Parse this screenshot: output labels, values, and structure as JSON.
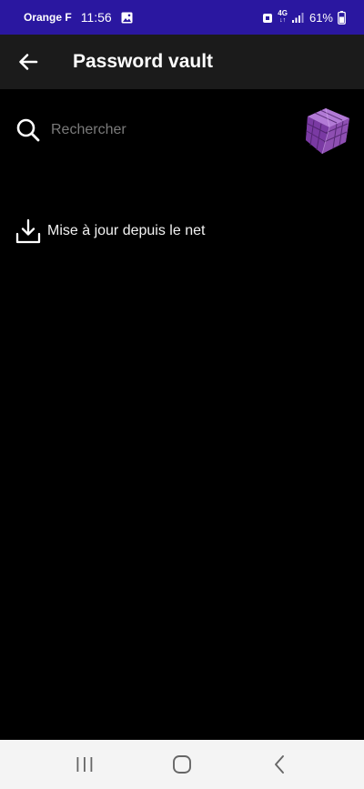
{
  "status_bar": {
    "carrier": "Orange F",
    "time": "11:56",
    "network": "4G",
    "battery": "61%"
  },
  "app_bar": {
    "title": "Password vault"
  },
  "search": {
    "placeholder": "Rechercher"
  },
  "actions": {
    "update_label": "Mise à jour depuis le net"
  },
  "colors": {
    "status_bar": "#2a17a0",
    "app_bar": "#1b1b1b",
    "background": "#000000",
    "nav_bar": "#f4f4f4",
    "logo": "#8e4fb2"
  },
  "icons": {
    "back": "arrow-left-icon",
    "search": "search-icon",
    "logo": "purple-cube-logo",
    "update": "download-icon",
    "nav_recents": "recents-icon",
    "nav_home": "home-icon",
    "nav_back": "nav-back-icon"
  }
}
